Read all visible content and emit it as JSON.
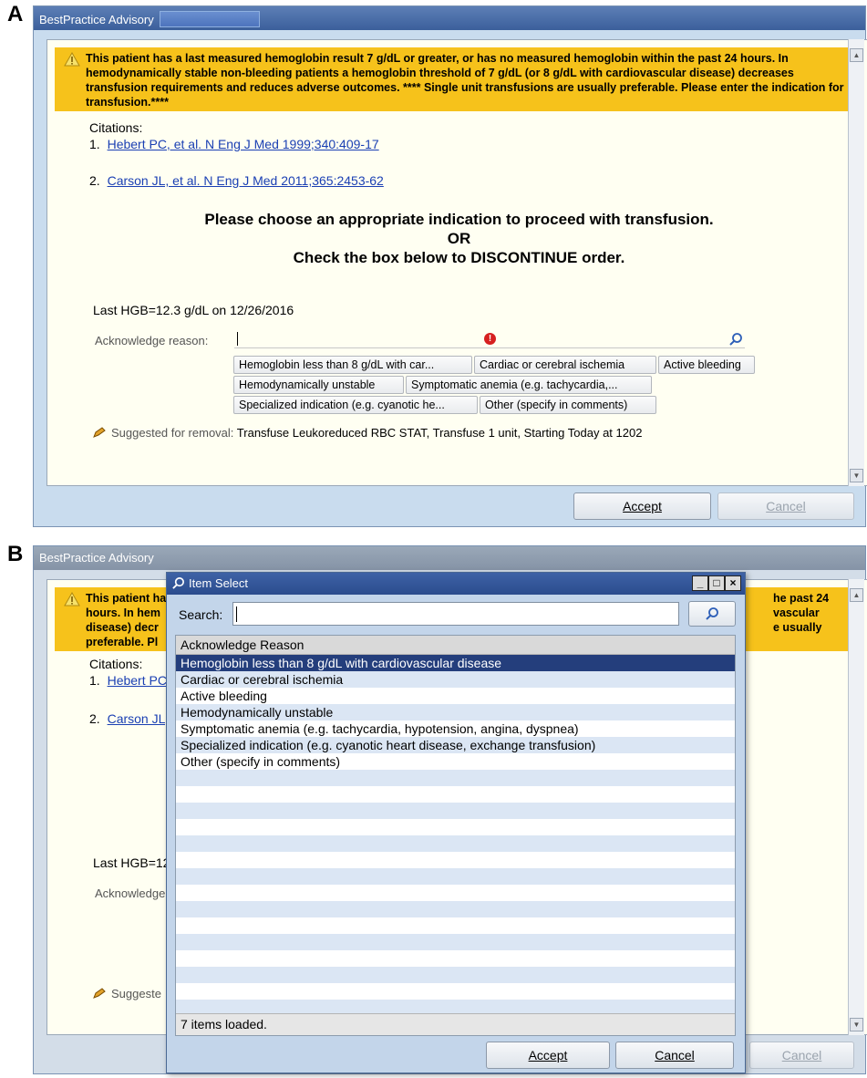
{
  "panels": {
    "a_label": "A",
    "b_label": "B"
  },
  "window": {
    "title": "BestPractice Advisory"
  },
  "advisory": {
    "banner": "This patient has a last measured hemoglobin result 7 g/dL or greater, or has no measured hemoglobin within the past 24 hours. In hemodynamically stable non-bleeding patients a hemoglobin threshold of 7 g/dL (or 8 g/dL with cardiovascular disease) decreases transfusion requirements and reduces adverse outcomes. **** Single unit transfusions are usually preferable. Please enter the indication for transfusion.****",
    "banner_b_lines": [
      "This patient ha",
      "hours. In hem",
      "disease) decr",
      "preferable. Pl"
    ],
    "banner_b_right_lines": [
      "he past 24",
      "vascular",
      "e usually"
    ],
    "citations_label": "Citations:",
    "citations": [
      {
        "num": "1.",
        "text": "Hebert PC, et al. N Eng J Med 1999;340:409-17",
        "text_b": "Hebert PC"
      },
      {
        "num": "2.",
        "text": "Carson JL, et al. N Eng J Med 2011;365:2453-62",
        "text_b": "Carson JL,"
      }
    ],
    "message_lines": [
      "Please choose an appropriate indication to proceed with transfusion.",
      "OR",
      "Check the box below to DISCONTINUE order."
    ],
    "last_hgb": "Last HGB=12.3 g/dL on 12/26/2016",
    "last_hgb_b": "Last HGB=12",
    "ack_label": "Acknowledge reason:",
    "ack_label_b": "Acknowledge",
    "ack_value": "",
    "options": [
      "Hemoglobin less than 8 g/dL with car...",
      "Cardiac or cerebral ischemia",
      "Active bleeding",
      "Hemodynamically unstable",
      "Symptomatic anemia (e.g. tachycardia,...",
      "Specialized indication (e.g. cyanotic he...",
      "Other (specify in comments)"
    ],
    "suggest_label": "Suggested for removal:",
    "suggest_label_b": "Suggeste",
    "suggest_text": "Transfuse Leukoreduced RBC STAT, Transfuse 1 unit, Starting Today at 1202",
    "accept": "Accept",
    "cancel": "Cancel"
  },
  "dialog": {
    "title": "Item Select",
    "search_label": "Search:",
    "search_value": "",
    "column_header": "Acknowledge Reason",
    "items": [
      "Hemoglobin less than 8 g/dL with cardiovascular disease",
      "Cardiac or cerebral ischemia",
      "Active bleeding",
      "Hemodynamically unstable",
      "Symptomatic anemia (e.g. tachycardia, hypotension, angina, dyspnea)",
      "Specialized indication (e.g. cyanotic heart disease, exchange transfusion)",
      "Other (specify in comments)"
    ],
    "selected_index": 0,
    "status": "7 items loaded.",
    "accept": "Accept",
    "cancel": "Cancel",
    "window_buttons": {
      "minimize": "_",
      "maximize": "□",
      "close": "×"
    }
  },
  "colors": {
    "banner": "#f6c21b",
    "content_bg": "#fffff2",
    "link": "#1a3fb3",
    "selection": "#243e7c",
    "window_frame": "#c9dcee"
  },
  "icons": [
    "warning-icon",
    "required-icon",
    "magnifier-icon",
    "pencil-icon",
    "scroll-up-icon",
    "scroll-down-icon"
  ]
}
